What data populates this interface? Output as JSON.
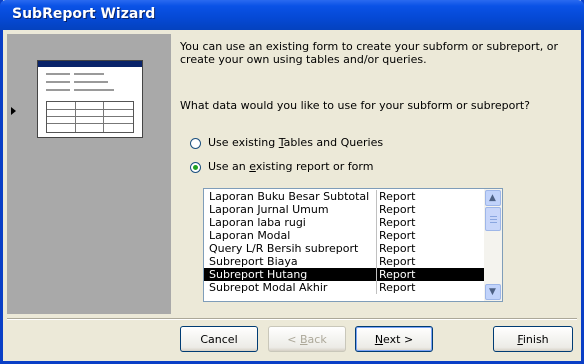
{
  "window": {
    "title": "SubReport Wizard"
  },
  "intro": {
    "line1": "You can use an existing form to create your subform or subreport, or",
    "line2": "create your own using tables and/or queries."
  },
  "question": "What data would you like to use for your subform or subreport?",
  "options": [
    {
      "label_pre": "Use existing ",
      "accel": "T",
      "label_post": "ables and Queries",
      "selected": false
    },
    {
      "label_pre": "Use an ",
      "accel": "e",
      "label_post": "xisting report or form",
      "selected": true
    }
  ],
  "list": {
    "rows": [
      {
        "name": "Laporan Buku Besar Subtotal",
        "type": "Report",
        "selected": false
      },
      {
        "name": "Laporan Jurnal Umum",
        "type": "Report",
        "selected": false
      },
      {
        "name": "Laporan laba rugi",
        "type": "Report",
        "selected": false
      },
      {
        "name": "Laporan Modal",
        "type": "Report",
        "selected": false
      },
      {
        "name": "Query L/R Bersih subreport",
        "type": "Report",
        "selected": false
      },
      {
        "name": "Subreport Biaya",
        "type": "Report",
        "selected": false
      },
      {
        "name": "Subreport Hutang",
        "type": "Report",
        "selected": true
      },
      {
        "name": "Subrepot Modal Akhir",
        "type": "Report",
        "selected": false
      }
    ]
  },
  "buttons": {
    "cancel": "Cancel",
    "back_pre": "< ",
    "back_accel": "B",
    "back_post": "ack",
    "next_accel": "N",
    "next_post": "ext >",
    "finish_accel": "F",
    "finish_post": "inish"
  },
  "colors": {
    "titlebar": "#0549D5",
    "dialog_bg": "#ECE9D8",
    "left_panel": "#A9A9A9",
    "selection": "#000000"
  }
}
